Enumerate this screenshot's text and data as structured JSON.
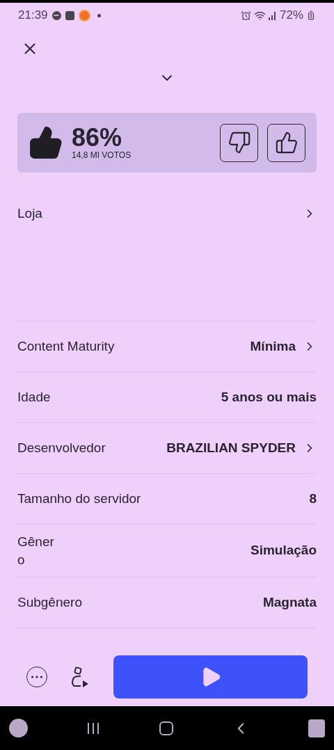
{
  "status_bar": {
    "time": "21:39",
    "battery": "72%"
  },
  "rating": {
    "percent": "86%",
    "votes": "14,8 MI VOTOS"
  },
  "store": {
    "label": "Loja"
  },
  "details": [
    {
      "label": "Content Maturity",
      "value": "Mínima",
      "link": true,
      "narrow": false
    },
    {
      "label": "Idade",
      "value": "5 anos ou mais",
      "link": false,
      "narrow": false
    },
    {
      "label": "Desenvolvedor",
      "value": "BRAZILIAN SPYDER",
      "link": true,
      "narrow": false
    },
    {
      "label": "Tamanho do servidor",
      "value": "8",
      "link": false,
      "narrow": false
    },
    {
      "label": "Gênero",
      "value": "Simulação",
      "link": false,
      "narrow": true
    },
    {
      "label": "Subgênero",
      "value": "Magnata",
      "link": false,
      "narrow": false
    }
  ]
}
